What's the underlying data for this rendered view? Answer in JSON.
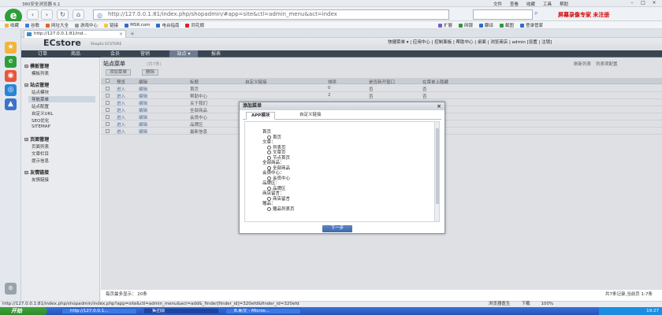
{
  "window": {
    "title": "360安全浏览器 6.1",
    "menu": [
      "文件",
      "查看",
      "收藏",
      "工具",
      "帮助"
    ]
  },
  "browser": {
    "address": "http://127.0.0.1:81/index.php/shopadmin/#app=site&ctl=admin_menu&act=index",
    "recorder": "屏幕录像专家 未注册",
    "favorites": [
      "收藏",
      "谷歌",
      "网址大全",
      "游戏中心",
      "链接",
      "MSR.com",
      "电台指南",
      "同花顺"
    ],
    "toolbar_right": [
      "扩展",
      "网银",
      "翻译",
      "截图",
      "登录管家"
    ],
    "tab_label": "http://127.0.0.1:81/ind...",
    "statusbar_url": "http://127.0.0.1:81/index.php/shopadmin/index.php?app=site&ctl=admin_menu&act=add&_finder[finder_id]=320efd&finder_id=320efd",
    "statusbar_right": [
      "浏览器医生",
      "下载",
      "100%"
    ]
  },
  "app": {
    "brand": "ECstore",
    "brand_sub": "ShopEx ECSTORE",
    "quick_links": "快捷菜单 ▾ | 应用中心 | 控制面板 | 帮助中心 | 桌面 | 浏览商店 | admin [设置 | 注销]",
    "nav": [
      "订单",
      "商品",
      "会员",
      "营销",
      "站点 ▾",
      "报表"
    ],
    "sidebar": [
      {
        "title": "模板管理",
        "items": [
          "模板列表"
        ]
      },
      {
        "title": "站点管理",
        "items": [
          "站点模块",
          "导航菜单",
          "站点配置",
          "自定义URL",
          "SEO优化",
          "SITEMAP"
        ]
      },
      {
        "title": "页面管理",
        "items": [
          "页面列表",
          "文章栏目",
          "提示信息"
        ]
      },
      {
        "title": "友情链接",
        "items": [
          "友情链接"
        ]
      }
    ],
    "content": {
      "title": "站点菜单",
      "count": "(共7条)",
      "right_links": [
        "刷新列表",
        "列表项配置"
      ],
      "add_btn": "添加菜单",
      "del_btn": "删除",
      "columns": [
        "",
        "预览",
        "编辑",
        "标题",
        "自定义链接",
        "排序",
        "是否新开窗口",
        "在菜单上隐藏"
      ],
      "rows": [
        [
          "进入",
          "编辑",
          "首页",
          "",
          "0",
          "否",
          "否"
        ],
        [
          "进入",
          "编辑",
          "帮助中心",
          "",
          "2",
          "否",
          "否"
        ],
        [
          "进入",
          "编辑",
          "关于我们",
          "",
          "",
          "",
          ""
        ],
        [
          "进入",
          "编辑",
          "全部商品",
          "",
          "",
          "",
          ""
        ],
        [
          "进入",
          "编辑",
          "会员中心",
          "",
          "",
          "",
          ""
        ],
        [
          "进入",
          "编辑",
          "品牌区",
          "",
          "",
          "",
          ""
        ],
        [
          "进入",
          "编辑",
          "最新信息",
          "",
          "",
          "",
          ""
        ]
      ],
      "footer_left": "每页最多显示： 20条",
      "footer_right": "共7条记录,当前页 1-7条"
    }
  },
  "modal": {
    "title": "添加菜单",
    "tabs": [
      "APP模块",
      "自定义链接"
    ],
    "tree": [
      {
        "t": "首页",
        "radio": false
      },
      {
        "t": "首页",
        "radio": true
      },
      {
        "t": "文章：",
        "radio": false
      },
      {
        "t": "列表页",
        "radio": true
      },
      {
        "t": "文章页",
        "radio": true
      },
      {
        "t": "节点首页",
        "radio": true
      },
      {
        "t": "全部商品：",
        "radio": false
      },
      {
        "t": "全部商品",
        "radio": true
      },
      {
        "t": "会员中心：",
        "radio": false
      },
      {
        "t": "会员中心",
        "radio": true
      },
      {
        "t": "品牌区：",
        "radio": false
      },
      {
        "t": "品牌区",
        "radio": true
      },
      {
        "t": "商店留言：",
        "radio": false
      },
      {
        "t": "商店留言",
        "radio": true
      },
      {
        "t": "赠品：",
        "radio": false
      },
      {
        "t": "赠品列表页",
        "radio": true
      }
    ],
    "next_btn": "下一步"
  },
  "taskbar": {
    "start": "开始",
    "tasks": [
      "http://127.0.0.1...",
      "集团版",
      "B.新文 - Micros..."
    ],
    "clock": "19:27"
  }
}
